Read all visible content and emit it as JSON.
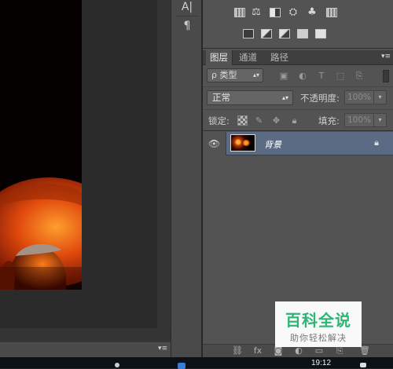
{
  "tool_column": {
    "tools": [
      {
        "name": "character-tool",
        "glyph": "A|"
      },
      {
        "name": "paragraph-tool",
        "glyph": "¶"
      }
    ]
  },
  "adjustments": {
    "row1": [
      "brightness-contrast-icon",
      "levels-icon",
      "curves-icon",
      "exposure-icon",
      "vibrance-icon",
      "hue-saturation-icon"
    ],
    "row2": [
      "photo-filter-icon",
      "gradient-map-icon",
      "selective-color-icon",
      "invert-icon",
      "threshold-icon"
    ]
  },
  "layers_panel": {
    "tabs": [
      {
        "label": "图层",
        "active": true
      },
      {
        "label": "通道",
        "active": false
      },
      {
        "label": "路径",
        "active": false
      }
    ],
    "filter": {
      "label": "ρ 类型"
    },
    "blend_mode": "正常",
    "opacity_label": "不透明度:",
    "opacity_value": "100%",
    "lock_label": "锁定:",
    "fill_label": "填充:",
    "fill_value": "100%",
    "layers": [
      {
        "name": "背景",
        "visible": true,
        "locked": true,
        "selected": true
      }
    ]
  },
  "watermark": {
    "title": "百科全说",
    "subtitle": "助你轻松解决"
  },
  "taskbar": {
    "clock": "19:12"
  },
  "colors": {
    "panel_bg": "#535353",
    "selected_layer": "#5a6b83",
    "watermark_green": "#2bb673"
  }
}
